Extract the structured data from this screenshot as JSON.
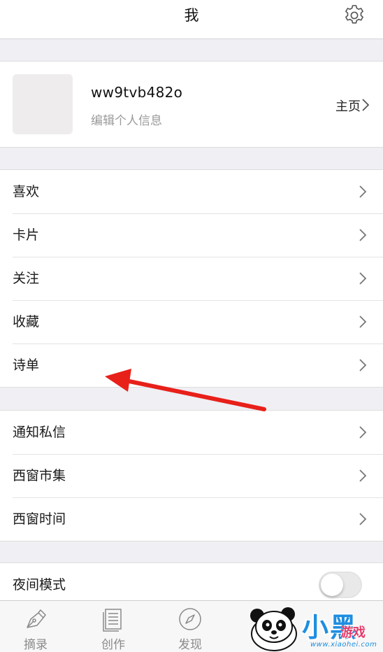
{
  "navbar": {
    "title": "我",
    "settings_icon": "gear-icon"
  },
  "profile": {
    "username": "ww9tvb482o",
    "edit_label": "编辑个人信息",
    "homepage_label": "主页"
  },
  "group1": {
    "items": [
      {
        "label": "喜欢"
      },
      {
        "label": "卡片"
      },
      {
        "label": "关注"
      },
      {
        "label": "收藏"
      },
      {
        "label": "诗单"
      }
    ]
  },
  "group2": {
    "items": [
      {
        "label": "通知私信"
      },
      {
        "label": "西窗市集"
      },
      {
        "label": "西窗时间"
      }
    ]
  },
  "group3": {
    "night_mode_label": "夜间模式",
    "night_mode_on": false
  },
  "tabbar": {
    "tabs": [
      {
        "label": "摘录",
        "icon": "pen-nib-icon"
      },
      {
        "label": "创作",
        "icon": "document-icon"
      },
      {
        "label": "发现",
        "icon": "compass-icon"
      }
    ]
  },
  "annotation": {
    "arrow_color": "#e8201a",
    "points_to": "诗单"
  },
  "watermark": {
    "main": "小黑",
    "sub": "游戏",
    "url": "www.xiaohei.com"
  },
  "colors": {
    "background": "#efeff4",
    "accent_watermark": "#1e8ee0"
  }
}
